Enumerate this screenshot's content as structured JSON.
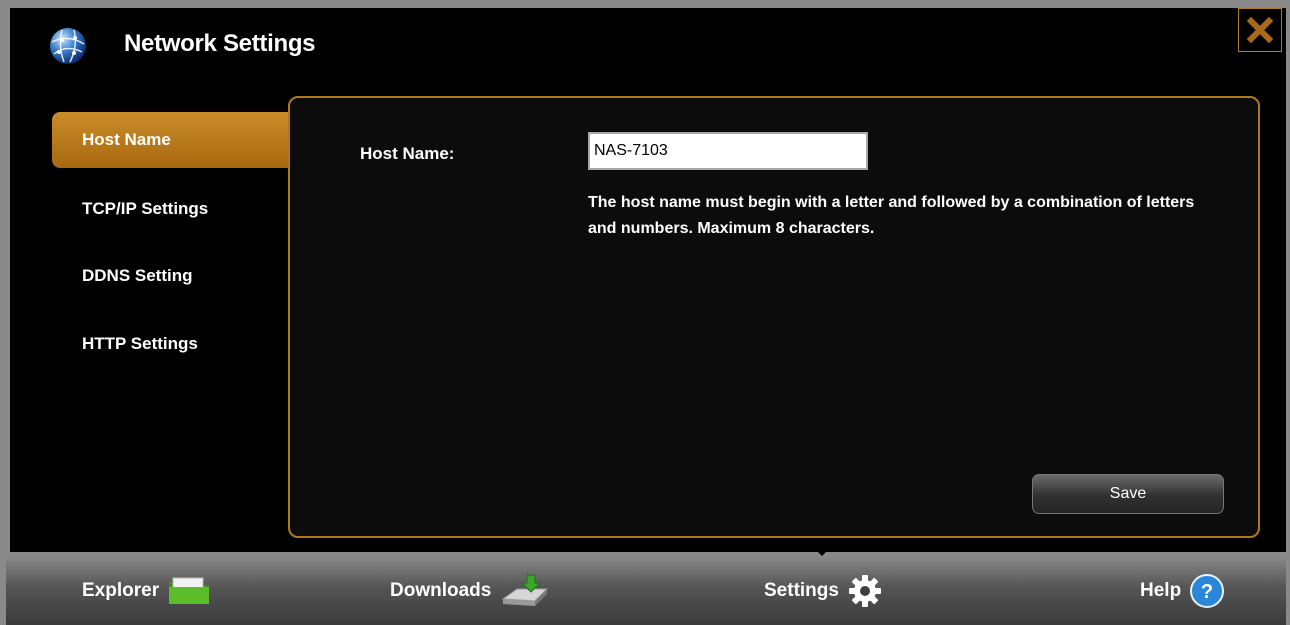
{
  "window": {
    "title": "Network Settings",
    "title_icon": "globe-network-icon",
    "close_icon": "close-icon"
  },
  "sidebar": {
    "items": [
      {
        "label": "Host Name",
        "active": true
      },
      {
        "label": "TCP/IP Settings",
        "active": false
      },
      {
        "label": "DDNS Setting",
        "active": false
      },
      {
        "label": "HTTP Settings",
        "active": false
      }
    ]
  },
  "host_form": {
    "label": "Host Name:",
    "value": "NAS-7103",
    "hint": "The host name must begin with a letter and followed by a combination of letters and numbers. Maximum 8 characters.",
    "save_label": "Save"
  },
  "taskbar": {
    "items": [
      {
        "label": "Explorer",
        "icon": "folder-icon"
      },
      {
        "label": "Downloads",
        "icon": "download-drive-icon"
      },
      {
        "label": "Settings",
        "icon": "gear-icon",
        "active": true
      },
      {
        "label": "Help",
        "icon": "help-icon"
      }
    ]
  },
  "colors": {
    "accent": "#b07a1a",
    "active_tab": "#c98d28",
    "help_blue": "#2a86d8",
    "download_green": "#3aa52a"
  }
}
